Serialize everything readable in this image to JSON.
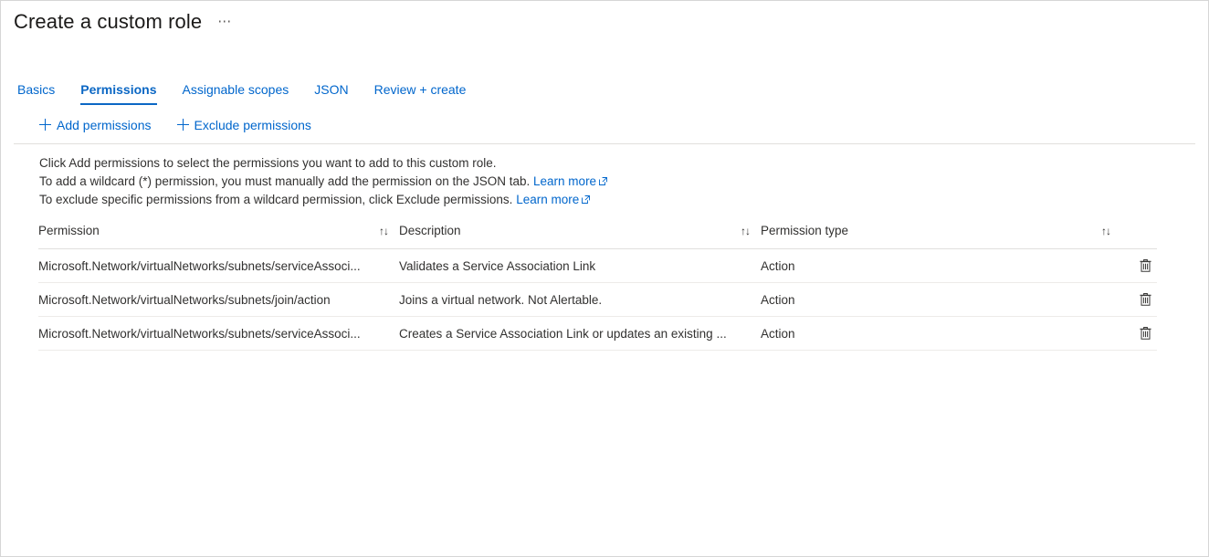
{
  "header": {
    "title": "Create a custom role",
    "ellipsis_label": "⋯"
  },
  "tabs": [
    {
      "label": "Basics",
      "active": false
    },
    {
      "label": "Permissions",
      "active": true
    },
    {
      "label": "Assignable scopes",
      "active": false
    },
    {
      "label": "JSON",
      "active": false
    },
    {
      "label": "Review + create",
      "active": false
    }
  ],
  "command_bar": {
    "buttons": [
      {
        "label": "Add permissions",
        "icon": "plus-icon"
      },
      {
        "label": "Exclude permissions",
        "icon": "plus-icon"
      }
    ]
  },
  "info": {
    "line1": "Click Add permissions to select the permissions you want to add to this custom role.",
    "line2_text": "To add a wildcard (*) permission, you must manually add the permission on the JSON tab.",
    "line2_link": "Learn more",
    "line3_text": "To exclude specific permissions from a wildcard permission, click Exclude permissions.",
    "line3_link": "Learn more"
  },
  "table": {
    "columns": [
      {
        "label": "Permission",
        "sort": "↑↓"
      },
      {
        "label": "Description",
        "sort": "↑↓"
      },
      {
        "label": "Permission type",
        "sort": "↑↓"
      }
    ],
    "rows": [
      {
        "permission": "Microsoft.Network/virtualNetworks/subnets/serviceAssoci...",
        "description": "Validates a Service Association Link",
        "type": "Action",
        "delete_icon": "trash-icon"
      },
      {
        "permission": "Microsoft.Network/virtualNetworks/subnets/join/action",
        "description": "Joins a virtual network. Not Alertable.",
        "type": "Action",
        "delete_icon": "trash-icon"
      },
      {
        "permission": "Microsoft.Network/virtualNetworks/subnets/serviceAssoci...",
        "description": "Creates a Service Association Link or updates an existing ...",
        "type": "Action",
        "delete_icon": "trash-icon"
      }
    ]
  },
  "colors": {
    "accent": "#0078d4",
    "link": "#0066cc",
    "text": "#323130",
    "border": "#e1dfdd"
  }
}
